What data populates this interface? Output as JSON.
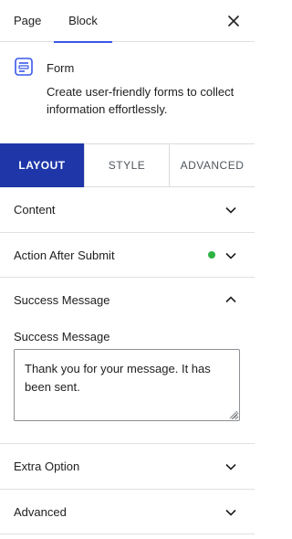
{
  "tabs": {
    "page": "Page",
    "block": "Block"
  },
  "block": {
    "title": "Form",
    "description": "Create user-friendly forms to collect information effortlessly."
  },
  "segments": {
    "layout": "LAYOUT",
    "style": "STYLE",
    "advanced": "ADVANCED"
  },
  "panels": {
    "content": "Content",
    "action_after_submit": "Action After Submit",
    "success_message": "Success Message",
    "extra_option": "Extra Option",
    "advanced": "Advanced"
  },
  "success_field": {
    "label": "Success Message",
    "value": "Thank you for your message. It has been sent."
  },
  "colors": {
    "accent": "#1e36a8",
    "tab_indicator": "#3858e9",
    "status_dot": "#2fb344",
    "icon": "#3858e9"
  },
  "icons": [
    "close-icon",
    "form-icon",
    "chevron-down-icon",
    "chevron-up-icon",
    "status-dot",
    "resize-grip-icon"
  ]
}
